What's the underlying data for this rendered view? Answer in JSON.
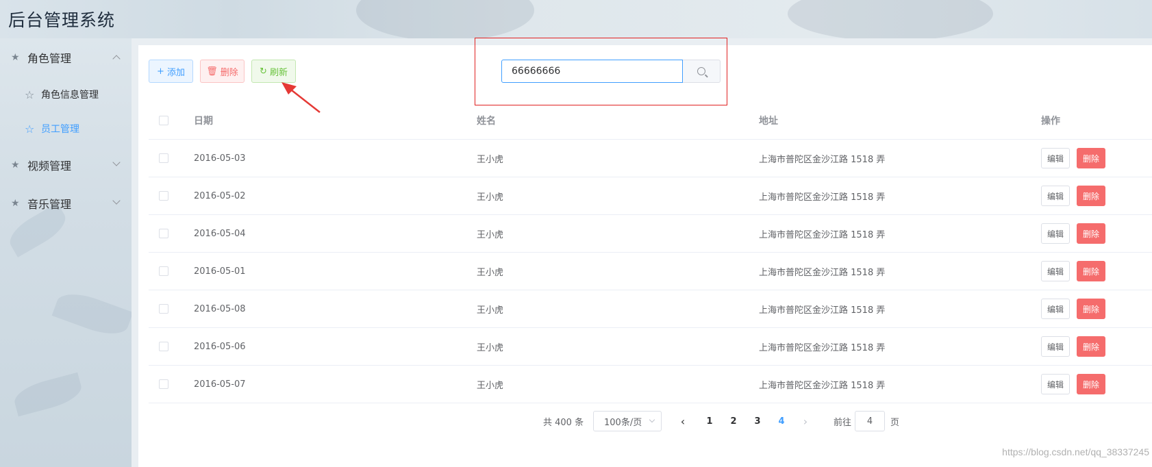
{
  "app": {
    "title": "后台管理系统"
  },
  "sidebar": {
    "groups": [
      {
        "label": "角色管理",
        "items": [
          {
            "label": "角色信息管理"
          },
          {
            "label": "员工管理"
          }
        ]
      },
      {
        "label": "视频管理"
      },
      {
        "label": "音乐管理"
      }
    ]
  },
  "toolbar": {
    "add_label": "添加",
    "delete_label": "删除",
    "refresh_label": "刷新"
  },
  "search": {
    "value": "66666666"
  },
  "table": {
    "columns": [
      "日期",
      "姓名",
      "地址",
      "操作"
    ],
    "rows": [
      {
        "date": "2016-05-03",
        "name": "王小虎",
        "address": "上海市普陀区金沙江路 1518 弄"
      },
      {
        "date": "2016-05-02",
        "name": "王小虎",
        "address": "上海市普陀区金沙江路 1518 弄"
      },
      {
        "date": "2016-05-04",
        "name": "王小虎",
        "address": "上海市普陀区金沙江路 1518 弄"
      },
      {
        "date": "2016-05-01",
        "name": "王小虎",
        "address": "上海市普陀区金沙江路 1518 弄"
      },
      {
        "date": "2016-05-08",
        "name": "王小虎",
        "address": "上海市普陀区金沙江路 1518 弄"
      },
      {
        "date": "2016-05-06",
        "name": "王小虎",
        "address": "上海市普陀区金沙江路 1518 弄"
      },
      {
        "date": "2016-05-07",
        "name": "王小虎",
        "address": "上海市普陀区金沙江路 1518 弄"
      }
    ],
    "edit_label": "编辑",
    "delete_label": "删除"
  },
  "pagination": {
    "total_text": "共 400 条",
    "page_size": "100条/页",
    "pages": [
      "1",
      "2",
      "3",
      "4"
    ],
    "current_page": "4",
    "goto_label": "前往",
    "goto_value": "4",
    "page_suffix": "页"
  },
  "watermark": "https://blog.csdn.net/qq_38337245",
  "colors": {
    "primary": "#409eff",
    "danger": "#f56c6c",
    "success": "#67c23a",
    "highlight_box": "#e02020",
    "arrow": "#e53935"
  }
}
